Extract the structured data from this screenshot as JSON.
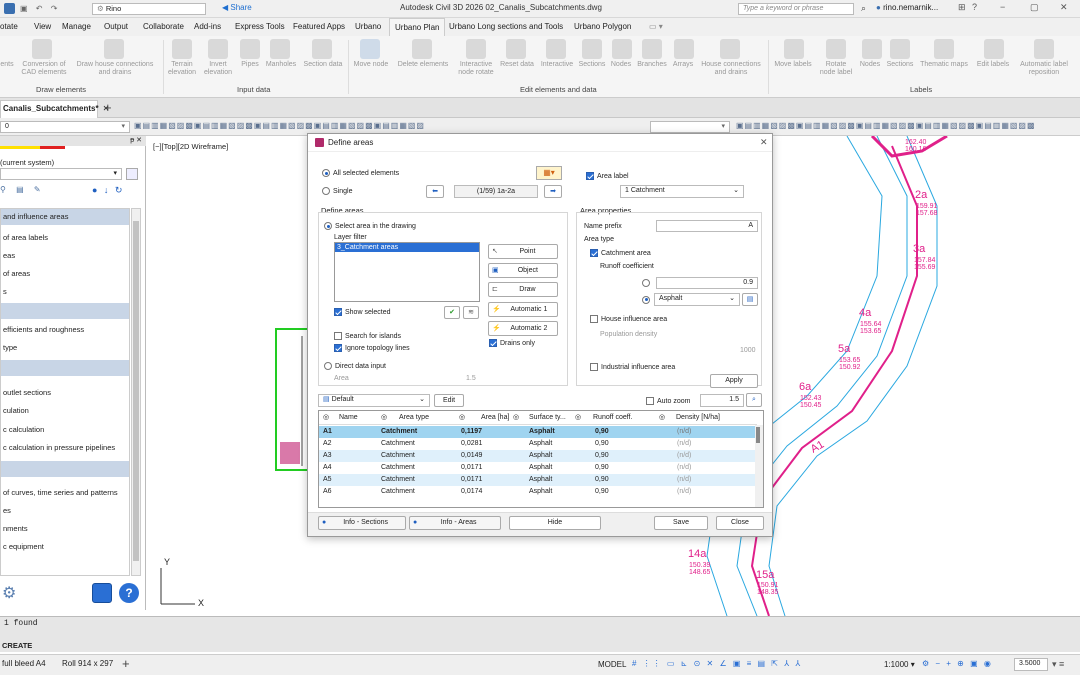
{
  "app": {
    "title": "Autodesk Civil 3D 2026   02_Canalis_Subcatchments.dwg",
    "workspace": "Rino",
    "share": "Share",
    "search_placeholder": "Type a keyword or phrase",
    "user": "rino.nemarnik..."
  },
  "menu": [
    "otate",
    "View",
    "Manage",
    "Output",
    "Collaborate",
    "Add-ins",
    "Express Tools",
    "Featured Apps",
    "Urbano"
  ],
  "tabs": {
    "active": "Urbano Plan",
    "others": [
      "Urbano Long sections and Tools",
      "Urbano Polygon"
    ]
  },
  "ribbon": {
    "items": [
      "ents",
      "Conversion of CAD elements",
      "Draw house connections and drains",
      "Terrain elevation",
      "Invert elevation",
      "Pipes",
      "Manholes",
      "Section data",
      "Move node",
      "Delete elements",
      "Interactive node rotate",
      "Reset data",
      "Interactive",
      "Sections",
      "Nodes",
      "Branches",
      "Arrays",
      "House connections and drains",
      "Move labels",
      "Rotate node label",
      "Nodes",
      "Sections",
      "Thematic maps",
      "Edit labels",
      "Automatic label reposition"
    ],
    "groups": [
      "Draw elements",
      "Input data",
      "Edit elements and data",
      "Labels"
    ]
  },
  "doc_tab": "Canalis_Subcatchments*",
  "viewport_label": "[−][Top][2D Wireframe]",
  "panel": {
    "system": "(current system)",
    "items": [
      {
        "label": "and influence areas",
        "type": "header"
      },
      {
        "label": "of area labels"
      },
      {
        "label": "eas"
      },
      {
        "label": "of areas"
      },
      {
        "label": "s"
      },
      {
        "label": "",
        "type": "header"
      },
      {
        "label": "efficients and roughness"
      },
      {
        "label": "type"
      },
      {
        "label": "",
        "type": "header"
      },
      {
        "label": "outlet sections"
      },
      {
        "label": "culation"
      },
      {
        "label": "c calculation"
      },
      {
        "label": "c calculation in pressure pipelines"
      },
      {
        "label": "",
        "type": "header"
      },
      {
        "label": "of curves, time series and patterns"
      },
      {
        "label": "es"
      },
      {
        "label": "nments"
      },
      {
        "label": "c equipment"
      }
    ]
  },
  "dialog": {
    "title": "Define areas",
    "all_selected": "All selected elements",
    "single": "Single",
    "nav_counter": "(1/59) 1a-2a",
    "area_label": "Area label",
    "area_label_value": "1 Catchment",
    "define_areas": "Define areas",
    "select_area": "Select area in the drawing",
    "layer_filter": "Layer filter",
    "layer_item": "3_Catchment areas",
    "btn_point": "Point",
    "btn_object": "Object",
    "btn_draw": "Draw",
    "btn_auto1": "Automatic 1",
    "btn_auto2": "Automatic 2",
    "drains_only": "Drains only",
    "show_selected": "Show selected",
    "search_islands": "Search for islands",
    "ignore_topology": "Ignore topology lines",
    "direct_input": "Direct data input",
    "area": "Area",
    "area_value": "1.5",
    "area_props": "Area properties",
    "name_prefix": "Name prefix",
    "name_prefix_value": "A",
    "area_type": "Area type",
    "catchment_area": "Catchment area",
    "runoff_coeff": "Runoff coefficient",
    "runoff_value": "0.9",
    "surface_value": "Asphalt",
    "house_area": "House influence area",
    "population_density": "Population density",
    "population_value": "1000",
    "industrial_area": "Industrial influence area",
    "apply": "Apply",
    "preset": "Default",
    "edit": "Edit",
    "auto_zoom": "Auto zoom",
    "zoom_value": "1.5",
    "columns": [
      "Name",
      "Area type",
      "Area [ha]",
      "Surface ty...",
      "Runoff coeff.",
      "Density [N/ha]"
    ],
    "rows": [
      [
        "A1",
        "Catchment",
        "0,1197",
        "Asphalt",
        "0,90",
        "(n/d)"
      ],
      [
        "A2",
        "Catchment",
        "0,0281",
        "Asphalt",
        "0,90",
        "(n/d)"
      ],
      [
        "A3",
        "Catchment",
        "0,0149",
        "Asphalt",
        "0,90",
        "(n/d)"
      ],
      [
        "A4",
        "Catchment",
        "0,0171",
        "Asphalt",
        "0,90",
        "(n/d)"
      ],
      [
        "A5",
        "Catchment",
        "0,0171",
        "Asphalt",
        "0,90",
        "(n/d)"
      ],
      [
        "A6",
        "Catchment",
        "0,0174",
        "Asphalt",
        "0,90",
        "(n/d)"
      ]
    ],
    "info_sections": "Info - Sections",
    "info_areas": "Info - Areas",
    "hide": "Hide",
    "save": "Save",
    "close": "Close"
  },
  "cad_labels": [
    {
      "name": "2a",
      "v1": "159.91",
      "v2": "157.68"
    },
    {
      "name": "3a",
      "v1": "157.84",
      "v2": "155.69"
    },
    {
      "name": "4a",
      "v1": "155.64",
      "v2": "153.65"
    },
    {
      "name": "5a",
      "v1": "153.65",
      "v2": "150.92"
    },
    {
      "name": "6a",
      "v1": "152.43",
      "v2": "150.45"
    },
    {
      "name": "14a",
      "v1": "150.39",
      "v2": "148.65"
    },
    {
      "name": "15a",
      "v1": "150.91",
      "v2": "148.35"
    }
  ],
  "cad_top": {
    "v1": "162.40",
    "v2": "160.16"
  },
  "cad_area_tag": "A1",
  "cmd": {
    "found": "1 found",
    "create": "CREATE"
  },
  "status": {
    "layout1": "full bleed A4",
    "layout2": "Roll 914 x 297",
    "model": "MODEL",
    "scale": "1:1000",
    "value": "3.5000"
  }
}
